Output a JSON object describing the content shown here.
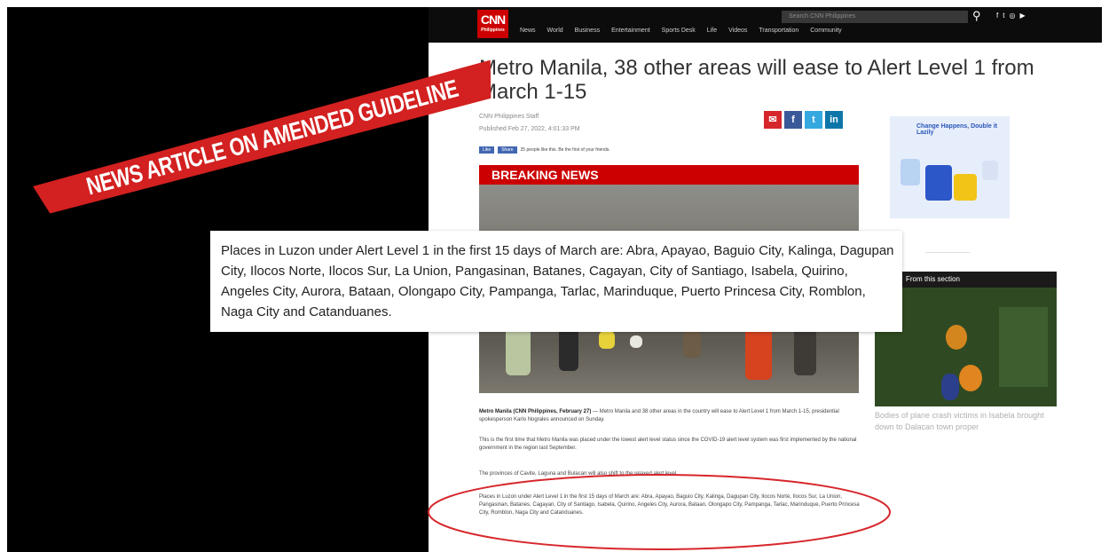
{
  "banner": {
    "text": "NEWS ARTICLE ON AMENDED GUIDELINE",
    "color": "#d32020"
  },
  "site": {
    "logo_text": "CNN",
    "logo_sub": "Philippines",
    "search_placeholder": "Search CNN Philippines",
    "nav": [
      "News",
      "World",
      "Business",
      "Entertainment",
      "Sports Desk",
      "Life",
      "Videos",
      "Transportation",
      "Community"
    ],
    "social_icons": [
      "facebook-icon",
      "twitter-icon",
      "instagram-icon",
      "youtube-icon"
    ],
    "brand_color": "#cc0000"
  },
  "article": {
    "headline": "Metro Manila, 38 other areas will ease to Alert Level 1 from March 1-15",
    "byline": "CNN Philippines Staff",
    "date": "Published Feb 27, 2022, 4:01:33 PM",
    "fb_like": "Like",
    "fb_share": "Share",
    "fb_text": "25 people like this. Be the first of your friends.",
    "share_icons": [
      "email-icon",
      "facebook-icon",
      "twitter-icon",
      "linkedin-icon"
    ],
    "breaking_label": "BREAKING NEWS",
    "lead_bold": "Metro Manila (CNN Philippines, February 27)",
    "lead_text": " — Metro Manila and 38 other areas in the country will ease to Alert Level 1 from March 1-15, presidential spokesperson Karlo Nograles announced on Sunday.",
    "para2": "This is the first time that Metro Manila was placed under the lowest alert level status since the COVID-19 alert level system was first implemented by the national government in the region last September.",
    "para3": "The provinces of Cavite, Laguna and Bulacan will also shift to the relaxed alert level.",
    "para4": "Places in Luzon under Alert Level 1 in the first 15 days of March are: Abra, Apayao, Baguio City, Kalinga, Dagupan City, Ilocos Norte, Ilocos Sur, La Union, Pangasinan, Batanes, Cagayan, City of Santiago, Isabela, Quirino, Angeles City, Aurora, Bataan, Olongapo City, Pampanga, Tarlac, Marinduque, Puerto Princesa City, Romblon, Naga City and Catanduanes."
  },
  "sidebar": {
    "ad_text": "Change Happens, Double it Lazily",
    "section_label": "From this section",
    "section_caption": "Bodies of plane crash victims in Isabela brought down to Dalacan town proper"
  },
  "popout": {
    "text": "Places in Luzon under Alert Level 1 in the first 15 days of March are: Abra, Apayao, Baguio City, Kalinga, Dagupan City, Ilocos Norte, Ilocos Sur, La Union, Pangasinan, Batanes, Cagayan, City of Santiago, Isabela, Quirino, Angeles City, Aurora, Bataan, Olongapo City, Pampanga, Tarlac, Marinduque, Puerto Princesa City, Romblon, Naga City and Catanduanes."
  }
}
